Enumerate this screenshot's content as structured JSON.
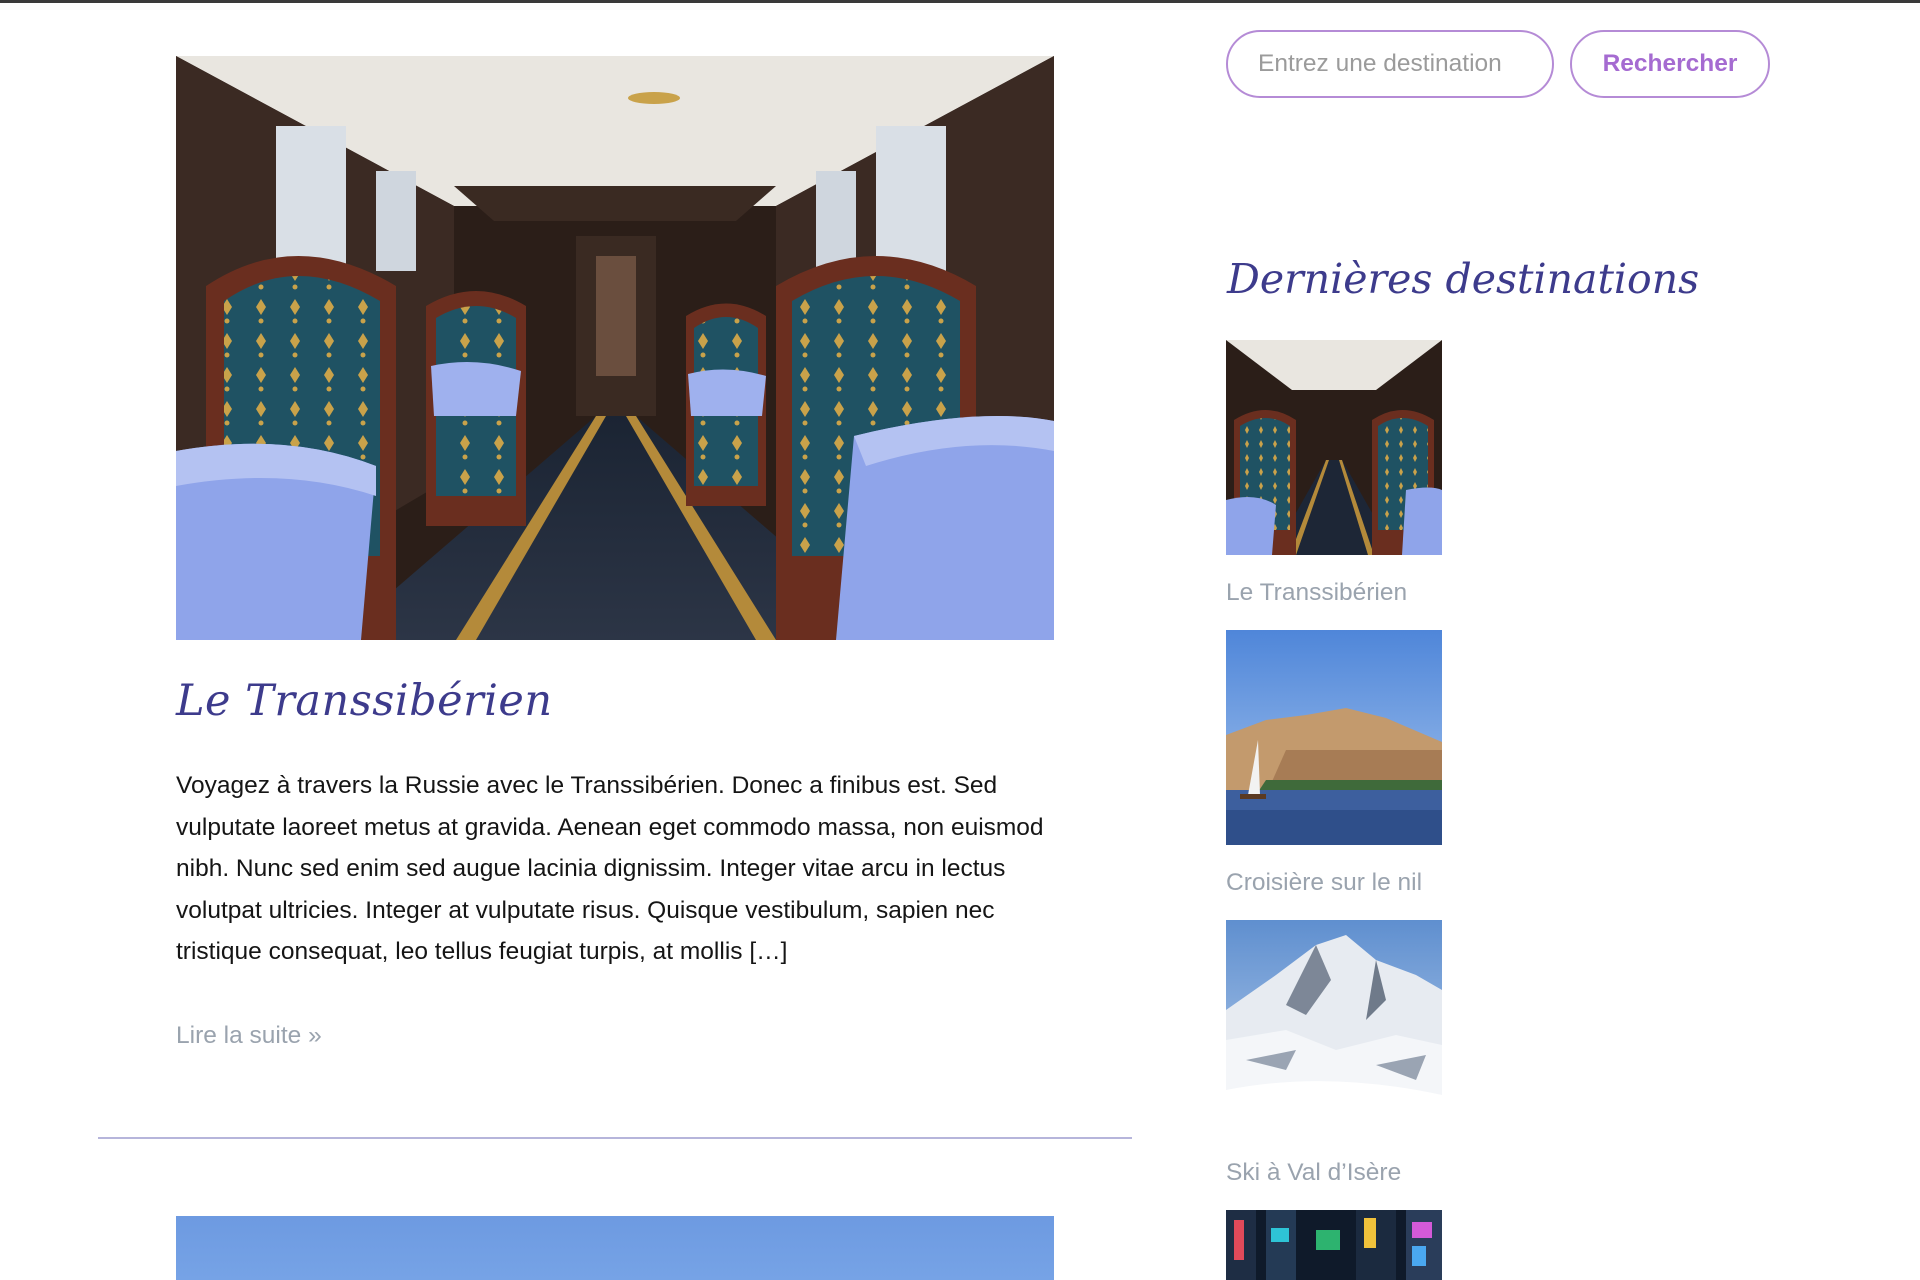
{
  "search": {
    "placeholder": "Entrez une destination",
    "button_label": "Rechercher"
  },
  "post": {
    "title": "Le Transsibérien",
    "excerpt": "Voyagez à travers la Russie avec le Transsibérien. Donec a finibus est. Sed vulputate laoreet metus at gravida. Aenean eget commodo massa, non euismod nibh. Nunc sed enim sed augue lacinia dignissim. Integer vitae arcu in lectus volutpat ultricies. Integer at vulputate risus. Quisque vestibulum, sapien nec tristique consequat, leo tellus feugiat turpis, at mollis […]",
    "read_more": "Lire la suite »",
    "image_icon": "train-dining-car-photo"
  },
  "sidebar": {
    "heading": "Dernières destinations",
    "destinations": [
      {
        "label": "Le Transsibérien",
        "image_icon": "train-dining-car-photo"
      },
      {
        "label": "Croisière sur le nil",
        "image_icon": "nile-sailboat-photo"
      },
      {
        "label": "Ski à Val d’Isère",
        "image_icon": "snowy-mountains-photo"
      },
      {
        "label": "",
        "image_icon": "city-neon-night-photo"
      }
    ]
  },
  "colors": {
    "heading": "#3d3b8c",
    "accent": "#a56bd1",
    "muted_link": "#9aa3ae",
    "divider": "#b6b5db"
  }
}
